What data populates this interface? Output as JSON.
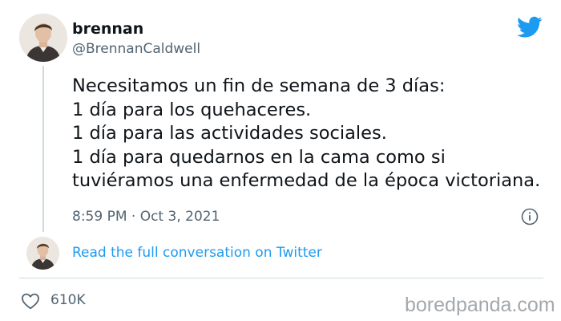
{
  "author": {
    "display_name": "brennan",
    "handle": "@BrennanCaldwell"
  },
  "tweet": {
    "lines": [
      "Necesitamos un fin de semana de 3 días:",
      "1 día para los quehaceres.",
      "1 día para las actividades sociales.",
      "1 día para quedarnos en la cama como si",
      "tuviéramos una enfermedad de la época victoriana."
    ],
    "timestamp": "8:59 PM · Oct 3, 2021"
  },
  "conversation_link": "Read the full conversation on Twitter",
  "stats": {
    "likes": "610K"
  },
  "watermark": "boredpanda.com",
  "icons": {
    "brand": "twitter-bird-icon",
    "info": "info-icon",
    "like": "heart-icon"
  },
  "colors": {
    "text": "#0f1419",
    "secondary": "#536471",
    "link": "#1d9bf0",
    "divider": "#cfd9de",
    "watermark": "#9a9fa5"
  }
}
